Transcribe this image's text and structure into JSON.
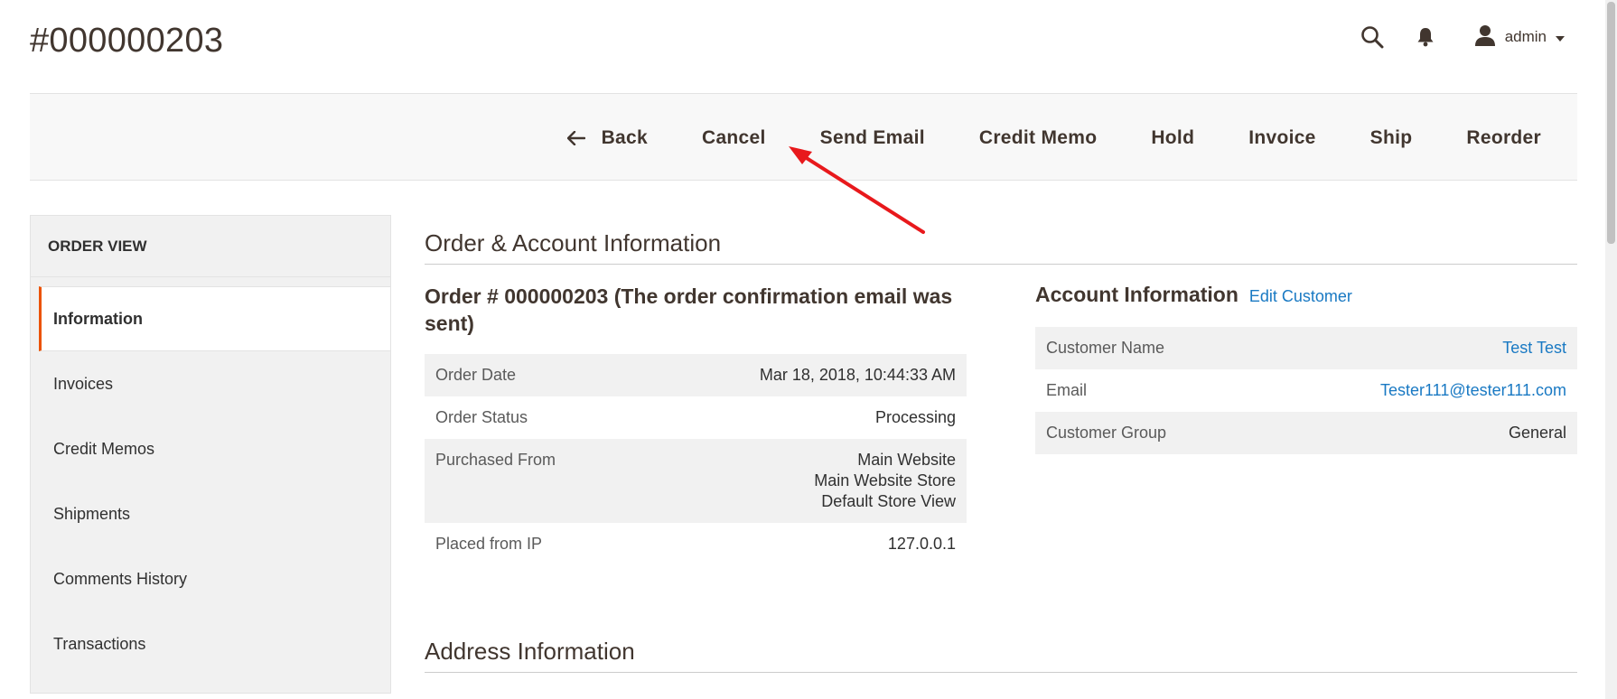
{
  "page": {
    "title": "#000000203"
  },
  "header": {
    "user": "admin",
    "icons": [
      "search-icon",
      "bell-icon",
      "user-icon"
    ]
  },
  "toolbar": {
    "back": "Back",
    "cancel": "Cancel",
    "send_email": "Send Email",
    "credit_memo": "Credit Memo",
    "hold": "Hold",
    "invoice": "Invoice",
    "ship": "Ship",
    "reorder": "Reorder"
  },
  "sidebar": {
    "title": "ORDER VIEW",
    "items": [
      {
        "label": "Information",
        "active": true
      },
      {
        "label": "Invoices"
      },
      {
        "label": "Credit Memos"
      },
      {
        "label": "Shipments"
      },
      {
        "label": "Comments History"
      },
      {
        "label": "Transactions"
      }
    ]
  },
  "main": {
    "section_title": "Order & Account Information",
    "order": {
      "heading": "Order # 000000203 (The order confirmation email was sent)",
      "rows": [
        {
          "label": "Order Date",
          "value": "Mar 18, 2018, 10:44:33 AM"
        },
        {
          "label": "Order Status",
          "value": "Processing"
        },
        {
          "label": "Purchased From",
          "value_lines": [
            "Main Website",
            "Main Website Store",
            "Default Store View"
          ]
        },
        {
          "label": "Placed from IP",
          "value": "127.0.0.1"
        }
      ]
    },
    "account": {
      "heading": "Account Information",
      "edit_link": "Edit Customer",
      "rows": [
        {
          "label": "Customer Name",
          "value": "Test Test"
        },
        {
          "label": "Email",
          "value": "Tester111@tester111.com"
        },
        {
          "label": "Customer Group",
          "value": "General"
        }
      ]
    },
    "address_title": "Address Information"
  },
  "colors": {
    "accent": "#eb5202",
    "link": "#1979c3",
    "annotation": "#e8191c",
    "text": "#41362f"
  }
}
